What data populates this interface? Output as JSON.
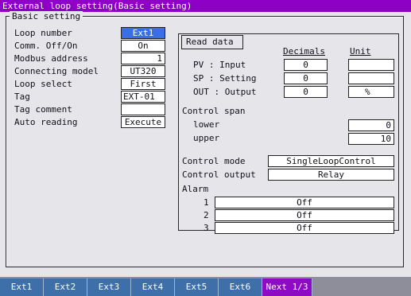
{
  "window": {
    "title": "External loop setting(Basic setting)"
  },
  "basic": {
    "group_label": "Basic setting",
    "rows": [
      {
        "label": "Loop number",
        "value": "Ext1"
      },
      {
        "label": "Comm. Off/On",
        "value": "On"
      },
      {
        "label": "Modbus address",
        "value": "1"
      },
      {
        "label": "Connecting model",
        "value": "UT320"
      },
      {
        "label": "Loop select",
        "value": "First"
      },
      {
        "label": "Tag",
        "value": "EXT-01"
      },
      {
        "label": "Tag comment",
        "value": ""
      },
      {
        "label": "Auto reading",
        "value": "Execute"
      }
    ]
  },
  "read_data": {
    "button_label": "Read data",
    "decimals_header": "Decimals",
    "unit_header": "Unit",
    "rows": [
      {
        "label": "PV : Input",
        "decimals": "0",
        "unit": ""
      },
      {
        "label": "SP : Setting",
        "decimals": "0",
        "unit": ""
      },
      {
        "label": "OUT : Output",
        "decimals": "0",
        "unit": "%"
      }
    ],
    "span_label": "Control span",
    "lower_label": "lower",
    "lower_value": "0",
    "upper_label": "upper",
    "upper_value": "10",
    "control_mode_label": "Control mode",
    "control_mode_value": "SingleLoopControl",
    "control_output_label": "Control output",
    "control_output_value": "Relay",
    "alarm_label": "Alarm",
    "alarms": [
      {
        "num": "1",
        "value": "Off"
      },
      {
        "num": "2",
        "value": "Off"
      },
      {
        "num": "3",
        "value": "Off"
      }
    ]
  },
  "tabs": [
    "Ext1",
    "Ext2",
    "Ext3",
    "Ext4",
    "Ext5",
    "Ext6",
    "Next 1/3"
  ],
  "colors": {
    "title_bar": "#8f00c6",
    "selected_field": "#3a6ee6",
    "tab": "#3f6fa9",
    "next_tab": "#8d0bc2"
  }
}
